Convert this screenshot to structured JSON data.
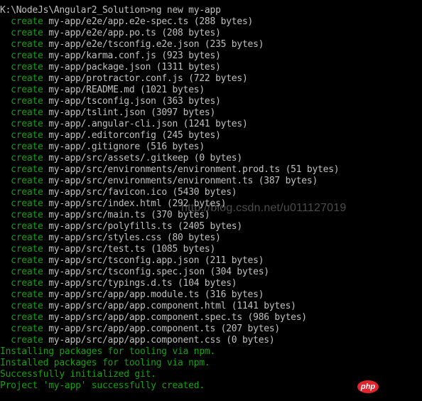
{
  "terminal": {
    "prompt_line": "K:\\NodeJs\\Angular2_Solution>ng new my-app",
    "create_keyword": "create",
    "created_files": [
      "my-app/e2e/app.e2e-spec.ts (288 bytes)",
      "my-app/e2e/app.po.ts (208 bytes)",
      "my-app/e2e/tsconfig.e2e.json (235 bytes)",
      "my-app/karma.conf.js (923 bytes)",
      "my-app/package.json (1311 bytes)",
      "my-app/protractor.conf.js (722 bytes)",
      "my-app/README.md (1021 bytes)",
      "my-app/tsconfig.json (363 bytes)",
      "my-app/tslint.json (3097 bytes)",
      "my-app/.angular-cli.json (1241 bytes)",
      "my-app/.editorconfig (245 bytes)",
      "my-app/.gitignore (516 bytes)",
      "my-app/src/assets/.gitkeep (0 bytes)",
      "my-app/src/environments/environment.prod.ts (51 bytes)",
      "my-app/src/environments/environment.ts (387 bytes)",
      "my-app/src/favicon.ico (5430 bytes)",
      "my-app/src/index.html (292 bytes)",
      "my-app/src/main.ts (370 bytes)",
      "my-app/src/polyfills.ts (2405 bytes)",
      "my-app/src/styles.css (80 bytes)",
      "my-app/src/test.ts (1085 bytes)",
      "my-app/src/tsconfig.app.json (211 bytes)",
      "my-app/src/tsconfig.spec.json (304 bytes)",
      "my-app/src/typings.d.ts (104 bytes)",
      "my-app/src/app/app.module.ts (316 bytes)",
      "my-app/src/app/app.component.html (1141 bytes)",
      "my-app/src/app/app.component.spec.ts (986 bytes)",
      "my-app/src/app/app.component.ts (207 bytes)",
      "my-app/src/app/app.component.css (0 bytes)"
    ],
    "status_lines": [
      "Installing packages for tooling via npm.",
      "Installed packages for tooling via npm.",
      "Successfully initialized git.",
      "Project 'my-app' successfully created."
    ]
  },
  "watermark": "http://blog.csdn.net/u011127019",
  "logo_text": "php",
  "colors": {
    "background": "#000000",
    "text": "#c0c0c0",
    "green": "#13a10e",
    "logo": "#e4242d"
  }
}
